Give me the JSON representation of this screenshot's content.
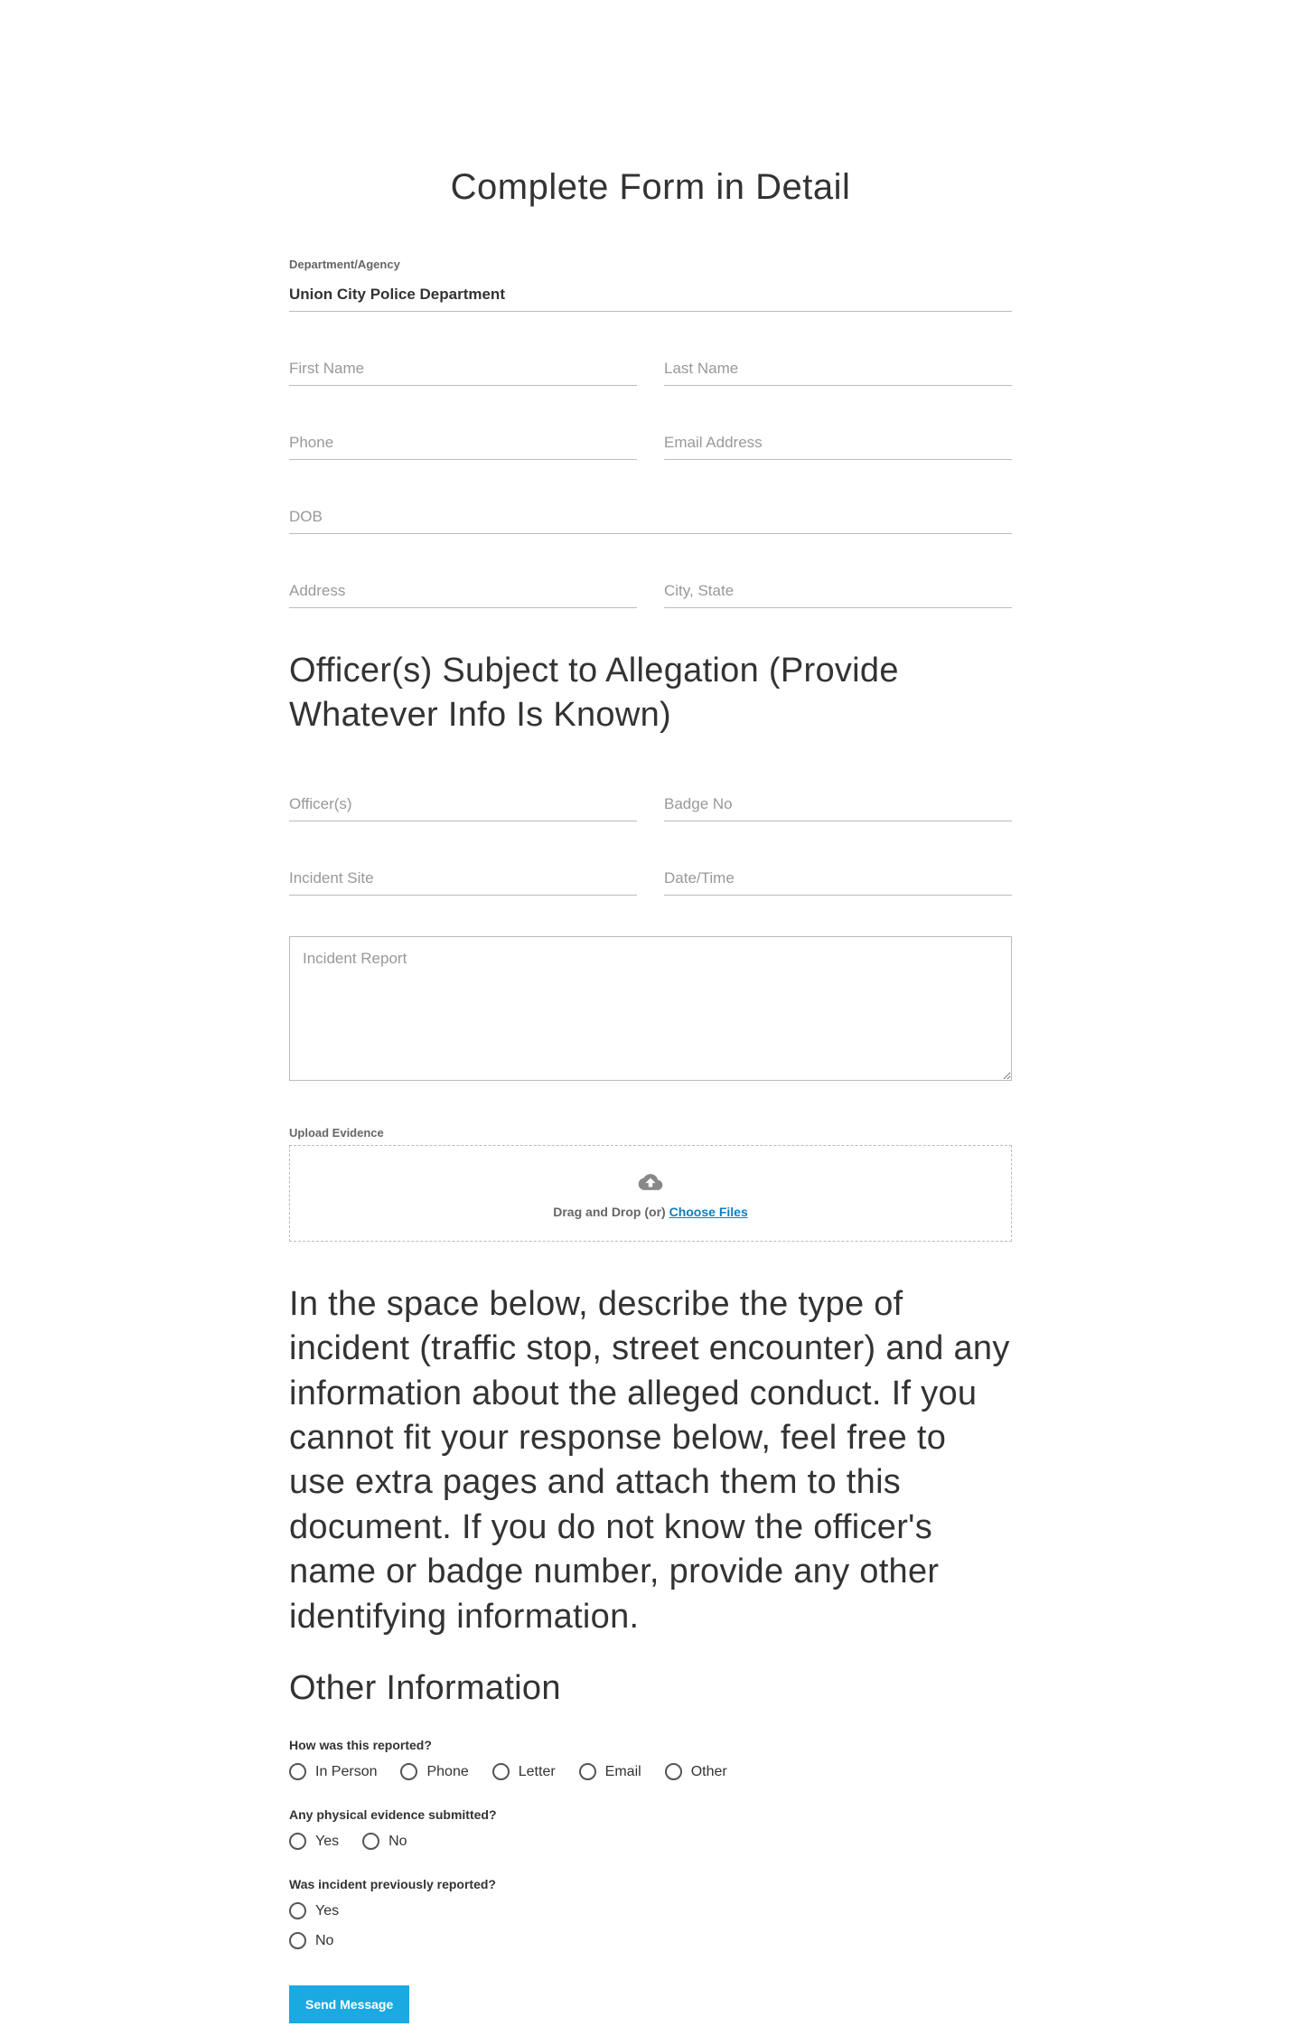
{
  "title": "Complete Form in Detail",
  "department": {
    "label": "Department/Agency",
    "value": "Union City Police Department"
  },
  "fields": {
    "first_name": "First Name",
    "last_name": "Last Name",
    "phone": "Phone",
    "email": "Email Address",
    "dob": "DOB",
    "address": "Address",
    "city_state": "City, State",
    "officers": "Officer(s)",
    "badge": "Badge No",
    "incident_site": "Incident Site",
    "date_time": "Date/Time",
    "incident_report": "Incident Report"
  },
  "section_officers": "Officer(s) Subject to Allegation (Provide Whatever Info Is Known)",
  "upload": {
    "label": "Upload Evidence",
    "drag_text": "Drag and Drop (or) ",
    "choose_text": "Choose Files"
  },
  "instruction": "In the space below, describe the type of incident (traffic stop, street encounter) and any information about the alleged conduct. If you cannot fit your response below, feel free to use extra pages and attach them to this document. If you do not know the officer's name or badge number, provide any other identifying information.",
  "other_info_heading": "Other Information",
  "q1": {
    "label": "How was this reported?",
    "options": [
      "In Person",
      "Phone",
      "Letter",
      "Email",
      "Other"
    ]
  },
  "q2": {
    "label": "Any physical evidence submitted?",
    "options": [
      "Yes",
      "No"
    ]
  },
  "q3": {
    "label": "Was incident previously reported?",
    "options": [
      "Yes",
      "No"
    ]
  },
  "submit": "Send Message"
}
